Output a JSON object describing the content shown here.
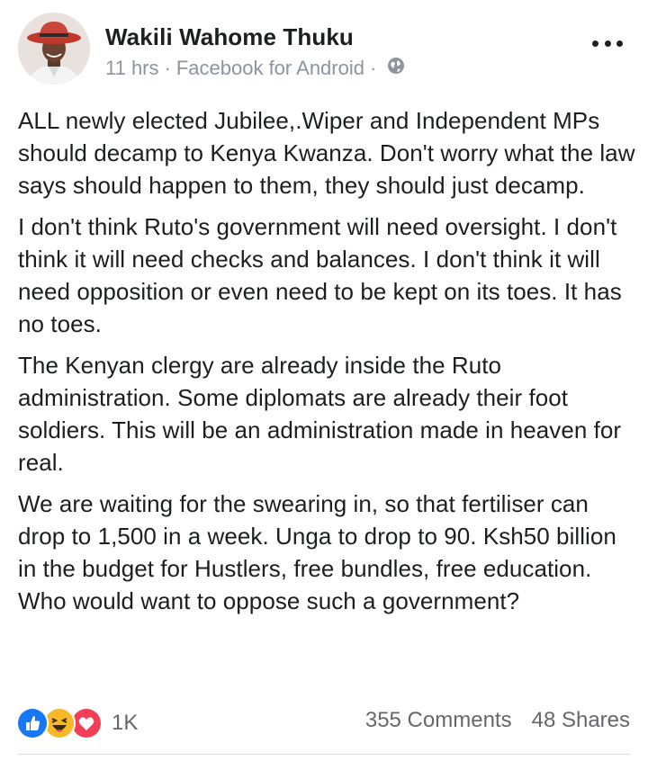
{
  "post": {
    "author": "Wakili Wahome Thuku",
    "meta": {
      "time": "11 hrs",
      "sep1": "·",
      "source": "Facebook for Android",
      "sep2": "·",
      "audience_icon": "globe-icon"
    },
    "more_icon": "more-options-icon",
    "paragraphs": [
      "ALL newly elected Jubilee,.Wiper and Independent MPs should decamp to Kenya Kwanza. Don't worry what the law says should happen to them, they should just decamp.",
      "I don't think Ruto's government will need oversight. I don't think it will need checks and balances. I don't think it will need opposition or even need to be kept on its toes. It has no toes.",
      "The Kenyan clergy are already inside the Ruto administration. Some diplomats are already their foot soldiers. This will be an administration made in heaven for real.",
      "We are waiting for the swearing in, so that fertiliser can drop to 1,500 in a week. Unga to drop to 90. Ksh50 billion in the budget for Hustlers, free bundles, free education. Who would want to oppose such a government?"
    ],
    "reactions": {
      "icons": [
        "like-icon",
        "haha-icon",
        "love-icon"
      ],
      "count": "1K"
    },
    "comments": "355 Comments",
    "shares": "48 Shares"
  },
  "colors": {
    "like": "#1877f2",
    "haha": "#f7b928",
    "love": "#f33e58",
    "meta_gray": "#8d949e",
    "text": "#1c1e21"
  }
}
